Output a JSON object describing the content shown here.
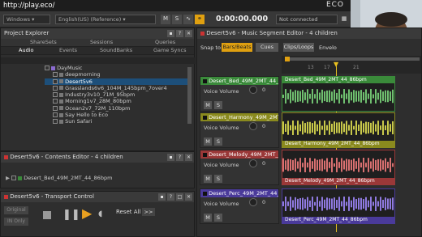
{
  "browser": {
    "url": "http://play.eco/"
  },
  "brand": {
    "logo_text": "ECO"
  },
  "topbar": {
    "platform": "Windows",
    "language": "English(US) (Reference)",
    "m_label": "M",
    "s_label": "S",
    "timecode": "0:00:00.000",
    "connection": "Not connected"
  },
  "project_explorer": {
    "title": "Project Explorer",
    "tabs_row1": [
      "ShareSets",
      "Sessions",
      "Queries"
    ],
    "tabs_row2": [
      "Audio",
      "Events",
      "SoundBanks",
      "Game Syncs"
    ],
    "items": [
      "DayMusic",
      "deepmorning",
      "Desert5v6",
      "Grasslands6v6_104M_145bpm_7over4",
      "Industry3v10_71M_95bpm",
      "Morning1v7_28M_80bpm",
      "Ocean2v7_72M_110bpm",
      "Say Hello to Eco",
      "Sun Safari"
    ]
  },
  "contents_editor": {
    "title": "Desert5v6 - Contents Editor - 4 children",
    "row_name": "Desert_Bed_49M_2MT_44_86bpm"
  },
  "transport": {
    "title": "Desert5v6 - Transport Control",
    "reset_all": "Reset All",
    "more": ">>",
    "original_label": "Original",
    "ino_label": "IN Only"
  },
  "segment_editor": {
    "title": "Desert5v6 - Music Segment Editor - 4 children",
    "snap_label": "Snap to:",
    "snap_options": [
      "Bars/Beats",
      "Cues",
      "Clips/Loops",
      "Envelo"
    ],
    "ruler_marks": [
      "13",
      "17",
      "21"
    ],
    "voice_volume_label": "Voice Volume",
    "voice_volume_value": "0",
    "tracks": [
      {
        "name": "Desert_Bed_49M_2MT_44_86bpm",
        "clip": "Desert_Bed_49M_2MT_44_86bpm",
        "color": "#3a8a3a"
      },
      {
        "name": "Desert_Harmony_49M_2MT_44_86bpm",
        "clip": "Desert_Harmony_49M_2MT_44_86bpm",
        "color": "#8a8a1e"
      },
      {
        "name": "Desert_Melody_49M_2MT_44_86bpm",
        "clip": "Desert_Melody_49M_2MT_44_86bpm",
        "color": "#9a3838"
      },
      {
        "name": "Desert_Perc_49M_2MT_44_86bpm",
        "clip": "Desert_Perc_49M_2MT_44_86bpm",
        "color": "#4a3a9a"
      }
    ]
  }
}
